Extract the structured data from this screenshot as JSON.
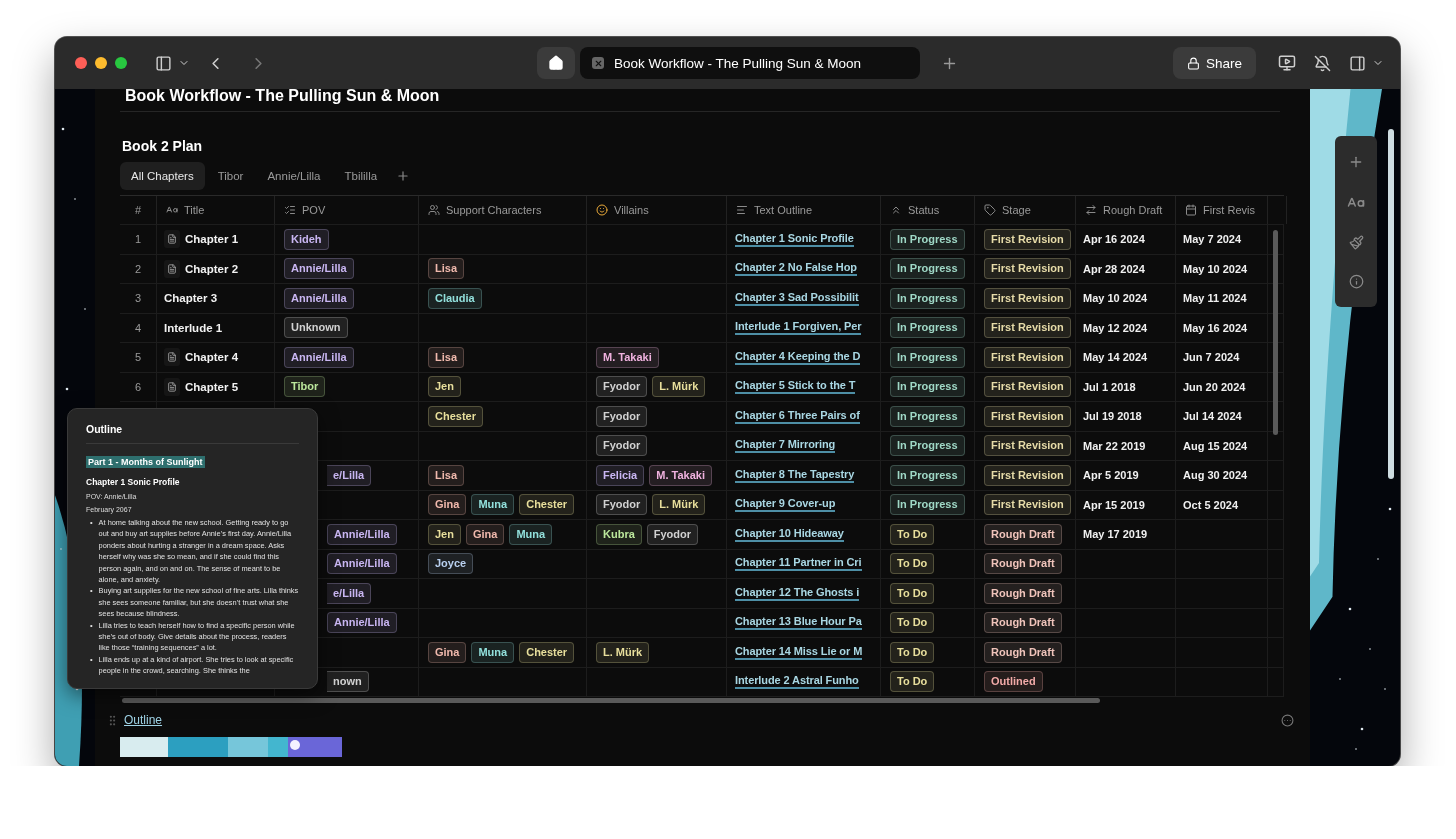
{
  "browser": {
    "tab_title": "Book Workflow - The Pulling Sun & Moon",
    "share_label": "Share"
  },
  "page": {
    "title": "Book Workflow - The Pulling Sun & Moon",
    "section_title": "Book 2 Plan"
  },
  "views": [
    {
      "label": "All Chapters",
      "selected": true
    },
    {
      "label": "Tibor",
      "selected": false
    },
    {
      "label": "Annie/Lilla",
      "selected": false
    },
    {
      "label": "Tbililla",
      "selected": false
    }
  ],
  "table": {
    "columns": [
      "#",
      "Title",
      "POV",
      "Support Characters",
      "Villains",
      "Text Outline",
      "Status",
      "Stage",
      "Rough Draft",
      "First Revis"
    ],
    "rows": [
      {
        "num": "1",
        "title": "Chapter 1",
        "has_page": true,
        "pov": [
          {
            "text": "Kideh",
            "color": "#c9b6f2"
          }
        ],
        "support": [],
        "villains": [],
        "outline": "Chapter 1 Sonic Profile",
        "status": {
          "text": "In Progress",
          "color": "#9fd8c6"
        },
        "stage": {
          "text": "First Revision",
          "color": "#e6dba8"
        },
        "rough_draft": "Apr 16 2024",
        "first_revision": "May 7 2024"
      },
      {
        "num": "2",
        "title": "Chapter 2",
        "has_page": true,
        "pov": [
          {
            "text": "Annie/Lilla",
            "color": "#c9b6f2"
          }
        ],
        "support": [
          {
            "text": "Lisa",
            "color": "#f0b9ad"
          }
        ],
        "villains": [],
        "outline": "Chapter 2 No False Hop",
        "status": {
          "text": "In Progress",
          "color": "#9fd8c6"
        },
        "stage": {
          "text": "First Revision",
          "color": "#e6dba8"
        },
        "rough_draft": "Apr 28 2024",
        "first_revision": "May 10 2024"
      },
      {
        "num": "3",
        "title": "Chapter 3",
        "has_page": false,
        "pov": [
          {
            "text": "Annie/Lilla",
            "color": "#c9b6f2"
          }
        ],
        "support": [
          {
            "text": "Claudia",
            "color": "#92e0dc"
          }
        ],
        "villains": [],
        "outline": "Chapter 3 Sad Possibilit",
        "status": {
          "text": "In Progress",
          "color": "#9fd8c6"
        },
        "stage": {
          "text": "First Revision",
          "color": "#e6dba8"
        },
        "rough_draft": "May 10 2024",
        "first_revision": "May 11 2024"
      },
      {
        "num": "4",
        "title": "Interlude 1",
        "has_page": false,
        "pov": [
          {
            "text": "Unknown",
            "color": "#d2d2d2"
          }
        ],
        "support": [],
        "villains": [],
        "outline": "Interlude 1 Forgiven, Per",
        "status": {
          "text": "In Progress",
          "color": "#9fd8c6"
        },
        "stage": {
          "text": "First Revision",
          "color": "#e6dba8"
        },
        "rough_draft": "May 12 2024",
        "first_revision": "May 16 2024"
      },
      {
        "num": "5",
        "title": "Chapter 4",
        "has_page": true,
        "pov": [
          {
            "text": "Annie/Lilla",
            "color": "#c9b6f2"
          }
        ],
        "support": [
          {
            "text": "Lisa",
            "color": "#f0b9ad"
          }
        ],
        "villains": [
          {
            "text": "M. Takaki",
            "color": "#f0b2df"
          }
        ],
        "outline": "Chapter 4 Keeping the D",
        "status": {
          "text": "In Progress",
          "color": "#9fd8c6"
        },
        "stage": {
          "text": "First Revision",
          "color": "#e6dba8"
        },
        "rough_draft": "May 14 2024",
        "first_revision": "Jun 7 2024"
      },
      {
        "num": "6",
        "title": "Chapter 5",
        "has_page": true,
        "pov": [
          {
            "text": "Tibor",
            "color": "#bce89c"
          }
        ],
        "support": [
          {
            "text": "Jen",
            "color": "#e8df9c"
          }
        ],
        "villains": [
          {
            "text": "Fyodor",
            "color": "#d2d2d2"
          },
          {
            "text": "L. Mürk",
            "color": "#e8df9c"
          }
        ],
        "outline": "Chapter 5 Stick to the T",
        "status": {
          "text": "In Progress",
          "color": "#9fd8c6"
        },
        "stage": {
          "text": "First Revision",
          "color": "#e6dba8"
        },
        "rough_draft": "Jul 1 2018",
        "first_revision": "Jun 20 2024"
      },
      {
        "pov": [],
        "support": [
          {
            "text": "Chester",
            "color": "#e8df9c"
          }
        ],
        "villains": [
          {
            "text": "Fyodor",
            "color": "#d2d2d2"
          }
        ],
        "outline": "Chapter 6 Three Pairs of",
        "status": {
          "text": "In Progress",
          "color": "#9fd8c6"
        },
        "stage": {
          "text": "First Revision",
          "color": "#e6dba8"
        },
        "rough_draft": "Jul 19 2018",
        "first_revision": "Jul 14 2024"
      },
      {
        "pov": [],
        "support": [],
        "villains": [
          {
            "text": "Fyodor",
            "color": "#d2d2d2"
          }
        ],
        "outline": "Chapter 7 Mirroring",
        "status": {
          "text": "In Progress",
          "color": "#9fd8c6"
        },
        "stage": {
          "text": "First Revision",
          "color": "#e6dba8"
        },
        "rough_draft": "Mar 22 2019",
        "first_revision": "Aug 15 2024"
      },
      {
        "pov": [
          {
            "text": "e/Lilla",
            "color": "#c9b6f2",
            "cut": true
          }
        ],
        "support": [
          {
            "text": "Lisa",
            "color": "#f0b9ad"
          }
        ],
        "villains": [
          {
            "text": "Felicia",
            "color": "#c9b6f2"
          },
          {
            "text": "M. Takaki",
            "color": "#f0b2df"
          }
        ],
        "outline": "Chapter 8 The Tapestry",
        "status": {
          "text": "In Progress",
          "color": "#9fd8c6"
        },
        "stage": {
          "text": "First Revision",
          "color": "#e6dba8"
        },
        "rough_draft": "Apr 5 2019",
        "first_revision": "Aug 30 2024"
      },
      {
        "pov": [],
        "support": [
          {
            "text": "Gina",
            "color": "#f0b9ad"
          },
          {
            "text": "Muna",
            "color": "#92e0dc"
          },
          {
            "text": "Chester",
            "color": "#e8df9c"
          }
        ],
        "villains": [
          {
            "text": "Fyodor",
            "color": "#d2d2d2"
          },
          {
            "text": "L. Mürk",
            "color": "#e8df9c"
          }
        ],
        "outline": "Chapter 9 Cover-up",
        "status": {
          "text": "In Progress",
          "color": "#9fd8c6"
        },
        "stage": {
          "text": "First Revision",
          "color": "#e6dba8"
        },
        "rough_draft": "Apr 15 2019",
        "first_revision": "Oct 5 2024"
      },
      {
        "pov": [
          {
            "text": "Annie/Lilla",
            "color": "#c9b6f2"
          }
        ],
        "support": [
          {
            "text": "Jen",
            "color": "#e8df9c"
          },
          {
            "text": "Gina",
            "color": "#f0b9ad"
          },
          {
            "text": "Muna",
            "color": "#92e0dc"
          }
        ],
        "villains": [
          {
            "text": "Kubra",
            "color": "#bce89c"
          },
          {
            "text": "Fyodor",
            "color": "#d2d2d2"
          }
        ],
        "outline": "Chapter 10 Hideaway",
        "status": {
          "text": "To Do",
          "color": "#e8df9c"
        },
        "stage": {
          "text": "Rough Draft",
          "color": "#f0c4bb"
        },
        "rough_draft": "May 17 2019"
      },
      {
        "pov": [
          {
            "text": "Annie/Lilla",
            "color": "#c9b6f2"
          }
        ],
        "support": [
          {
            "text": "Joyce",
            "color": "#b9d0f0"
          }
        ],
        "villains": [],
        "outline": "Chapter 11 Partner in Cri",
        "status": {
          "text": "To Do",
          "color": "#e8df9c"
        },
        "stage": {
          "text": "Rough Draft",
          "color": "#f0c4bb"
        }
      },
      {
        "pov": [
          {
            "text": "e/Lilla",
            "color": "#c9b6f2",
            "cut": true
          }
        ],
        "support": [],
        "villains": [],
        "outline": "Chapter 12 The Ghosts i",
        "status": {
          "text": "To Do",
          "color": "#e8df9c"
        },
        "stage": {
          "text": "Rough Draft",
          "color": "#f0c4bb"
        }
      },
      {
        "pov": [
          {
            "text": "Annie/Lilla",
            "color": "#c9b6f2"
          }
        ],
        "support": [],
        "villains": [],
        "outline": "Chapter 13 Blue Hour Pa",
        "status": {
          "text": "To Do",
          "color": "#e8df9c"
        },
        "stage": {
          "text": "Rough Draft",
          "color": "#f0c4bb"
        }
      },
      {
        "pov": [],
        "support": [
          {
            "text": "Gina",
            "color": "#f0b9ad"
          },
          {
            "text": "Muna",
            "color": "#92e0dc"
          },
          {
            "text": "Chester",
            "color": "#e8df9c"
          }
        ],
        "villains": [
          {
            "text": "L. Mürk",
            "color": "#e8df9c"
          }
        ],
        "outline": "Chapter 14 Miss Lie or M",
        "status": {
          "text": "To Do",
          "color": "#e8df9c"
        },
        "stage": {
          "text": "Rough Draft",
          "color": "#f0c4bb"
        }
      },
      {
        "pov": [
          {
            "text": "nown",
            "color": "#d2d2d2",
            "cut": true
          }
        ],
        "support": [],
        "villains": [],
        "outline": "Interlude 2 Astral Funho",
        "status": {
          "text": "To Do",
          "color": "#e8df9c"
        },
        "stage": {
          "text": "Outlined",
          "color": "#f2aaa8"
        }
      }
    ]
  },
  "outline_popup": {
    "title": "Outline",
    "bullet_marker": "•",
    "heading": "Part 1 - Months of Sunlight",
    "subheading": "Chapter 1 Sonic Profile",
    "lines": [
      "POV: Annie/Lilla",
      "February 2067"
    ],
    "bullets": [
      "At home talking about the new school. Getting ready to go out and buy art supplies before Annie’s first day. Annie/Lilla ponders about hurting a stranger in a dream space. Asks herself why was she so mean, and if she could find this person again, and on and on. The sense of meant to be alone, and anxiety.",
      "Buying art supplies for the new school of fine arts. Lilla thinks she sees someone familiar, but she doesn’t trust what she sees because blindness.",
      "Lilla tries to teach herself how to find a specific person while she’s out of body. Give details about the process, readers like those “training sequences” a lot.",
      "Lilla ends up at a kind of airport. She tries to look at specific people in the crowd, searching. She thinks the"
    ]
  },
  "footer": {
    "link": "Outline"
  }
}
